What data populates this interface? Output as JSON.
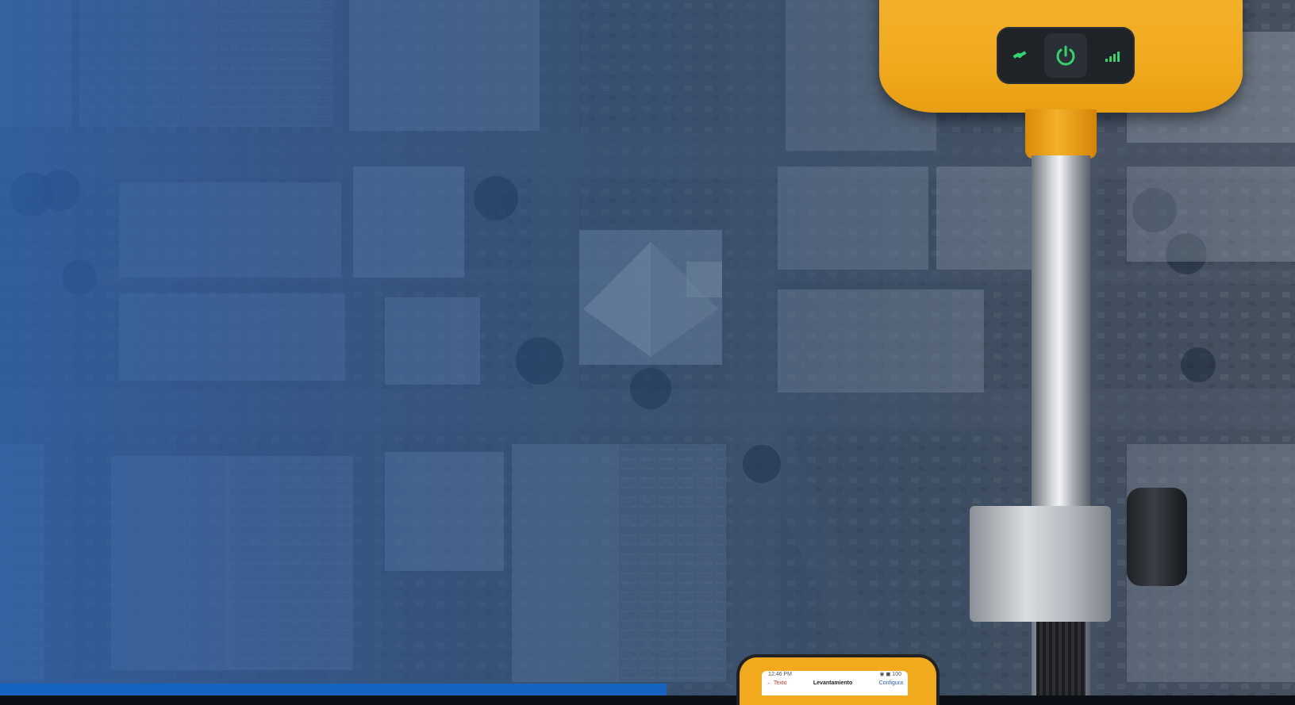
{
  "colors": {
    "receiver": "#f2b12b",
    "panel": "#1f2328",
    "led": "#35d36b",
    "map_tint": "#2d5ea6",
    "accent_bar": "#1565c0"
  },
  "receiver": {
    "icons": [
      "satellite-icon",
      "power-icon",
      "signal-bars-icon"
    ]
  },
  "controller": {
    "status_time": "12:46 PM",
    "status_right": "◉ ◼ 100",
    "app_back": "← Texto",
    "app_title": "Levantamiento",
    "app_action": "Configura"
  }
}
